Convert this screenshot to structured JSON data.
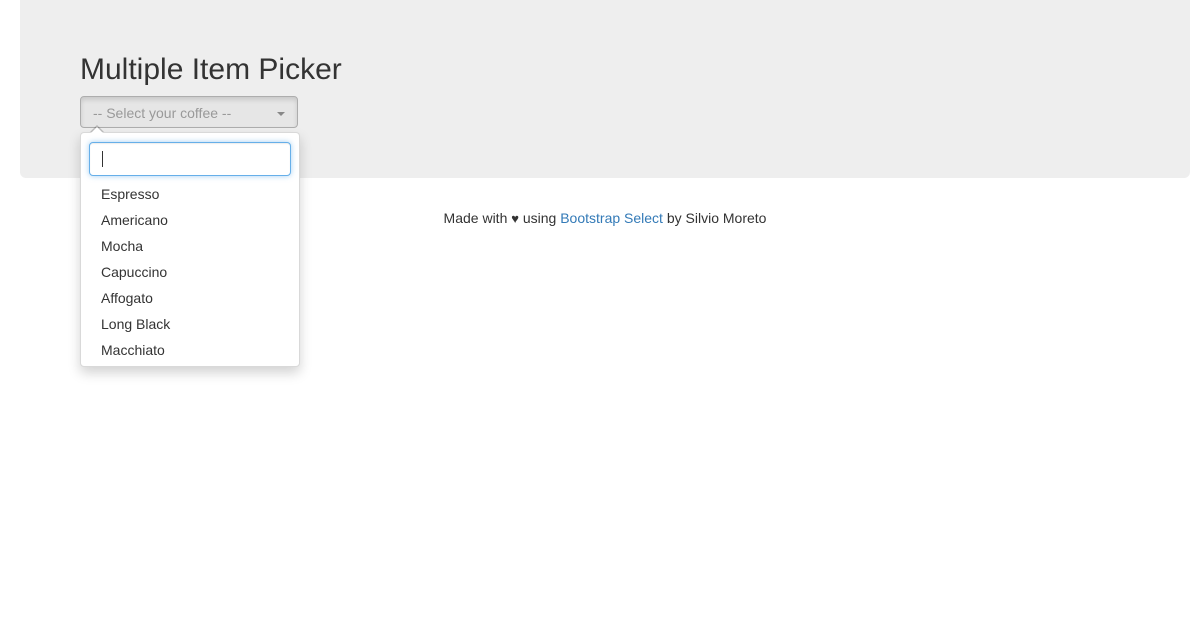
{
  "header": {
    "title": "Multiple Item Picker"
  },
  "picker": {
    "placeholder": "-- Select your coffee --",
    "search_value": "",
    "options": [
      "Espresso",
      "Americano",
      "Mocha",
      "Capuccino",
      "Affogato",
      "Long Black",
      "Macchiato"
    ]
  },
  "footer": {
    "made_with": "Made with",
    "heart": "♥",
    "using": "using",
    "link_text": "Bootstrap Select",
    "by_text": "by Silvio Moreto"
  },
  "colors": {
    "jumbotron_bg": "#eeeeee",
    "link": "#337ab7",
    "focus_border": "#66afe9"
  },
  "icons": {
    "caret": "caret-down-icon",
    "heart": "heart-icon"
  }
}
